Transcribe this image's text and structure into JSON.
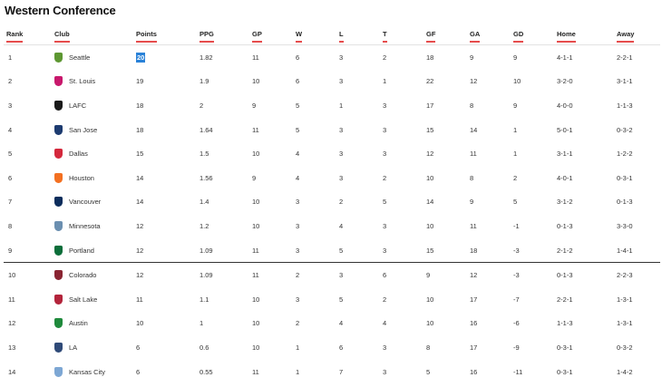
{
  "title": "Western Conference",
  "columns": [
    "Rank",
    "Club",
    "Points",
    "PPG",
    "GP",
    "W",
    "L",
    "T",
    "GF",
    "GA",
    "GD",
    "Home",
    "Away"
  ],
  "rows": [
    {
      "rank": "1",
      "club": "Seattle",
      "color": "#5d9732",
      "points": "20",
      "ppg": "1.82",
      "gp": "11",
      "w": "6",
      "l": "3",
      "t": "2",
      "gf": "18",
      "ga": "9",
      "gd": "9",
      "home": "4-1-1",
      "away": "2-2-1"
    },
    {
      "rank": "2",
      "club": "St. Louis",
      "color": "#c8186c",
      "points": "19",
      "ppg": "1.9",
      "gp": "10",
      "w": "6",
      "l": "3",
      "t": "1",
      "gf": "22",
      "ga": "12",
      "gd": "10",
      "home": "3-2-0",
      "away": "3-1-1"
    },
    {
      "rank": "3",
      "club": "LAFC",
      "color": "#1a1a1a",
      "points": "18",
      "ppg": "2",
      "gp": "9",
      "w": "5",
      "l": "1",
      "t": "3",
      "gf": "17",
      "ga": "8",
      "gd": "9",
      "home": "4-0-0",
      "away": "1-1-3"
    },
    {
      "rank": "4",
      "club": "San Jose",
      "color": "#1d3b70",
      "points": "18",
      "ppg": "1.64",
      "gp": "11",
      "w": "5",
      "l": "3",
      "t": "3",
      "gf": "15",
      "ga": "14",
      "gd": "1",
      "home": "5-0-1",
      "away": "0-3-2"
    },
    {
      "rank": "5",
      "club": "Dallas",
      "color": "#d4283c",
      "points": "15",
      "ppg": "1.5",
      "gp": "10",
      "w": "4",
      "l": "3",
      "t": "3",
      "gf": "12",
      "ga": "11",
      "gd": "1",
      "home": "3-1-1",
      "away": "1-2-2"
    },
    {
      "rank": "6",
      "club": "Houston",
      "color": "#f37021",
      "points": "14",
      "ppg": "1.56",
      "gp": "9",
      "w": "4",
      "l": "3",
      "t": "2",
      "gf": "10",
      "ga": "8",
      "gd": "2",
      "home": "4-0-1",
      "away": "0-3-1"
    },
    {
      "rank": "7",
      "club": "Vancouver",
      "color": "#0b2d5c",
      "points": "14",
      "ppg": "1.4",
      "gp": "10",
      "w": "3",
      "l": "2",
      "t": "5",
      "gf": "14",
      "ga": "9",
      "gd": "5",
      "home": "3-1-2",
      "away": "0-1-3"
    },
    {
      "rank": "8",
      "club": "Minnesota",
      "color": "#6b8fb0",
      "points": "12",
      "ppg": "1.2",
      "gp": "10",
      "w": "3",
      "l": "4",
      "t": "3",
      "gf": "10",
      "ga": "11",
      "gd": "-1",
      "home": "0-1-3",
      "away": "3-3-0"
    },
    {
      "rank": "9",
      "club": "Portland",
      "color": "#0b6e3a",
      "points": "12",
      "ppg": "1.09",
      "gp": "11",
      "w": "3",
      "l": "5",
      "t": "3",
      "gf": "15",
      "ga": "18",
      "gd": "-3",
      "home": "2-1-2",
      "away": "1-4-1"
    },
    {
      "rank": "10",
      "club": "Colorado",
      "color": "#8a2432",
      "points": "12",
      "ppg": "1.09",
      "gp": "11",
      "w": "2",
      "l": "3",
      "t": "6",
      "gf": "9",
      "ga": "12",
      "gd": "-3",
      "home": "0-1-3",
      "away": "2-2-3"
    },
    {
      "rank": "11",
      "club": "Salt Lake",
      "color": "#b3243b",
      "points": "11",
      "ppg": "1.1",
      "gp": "10",
      "w": "3",
      "l": "5",
      "t": "2",
      "gf": "10",
      "ga": "17",
      "gd": "-7",
      "home": "2-2-1",
      "away": "1-3-1"
    },
    {
      "rank": "12",
      "club": "Austin",
      "color": "#1f8a3c",
      "points": "10",
      "ppg": "1",
      "gp": "10",
      "w": "2",
      "l": "4",
      "t": "4",
      "gf": "10",
      "ga": "16",
      "gd": "-6",
      "home": "1-1-3",
      "away": "1-3-1"
    },
    {
      "rank": "13",
      "club": "LA",
      "color": "#2f4a78",
      "points": "6",
      "ppg": "0.6",
      "gp": "10",
      "w": "1",
      "l": "6",
      "t": "3",
      "gf": "8",
      "ga": "17",
      "gd": "-9",
      "home": "0-3-1",
      "away": "0-3-2"
    },
    {
      "rank": "14",
      "club": "Kansas City",
      "color": "#7da7d4",
      "points": "6",
      "ppg": "0.55",
      "gp": "11",
      "w": "1",
      "l": "7",
      "t": "3",
      "gf": "5",
      "ga": "16",
      "gd": "-11",
      "home": "0-3-1",
      "away": "1-4-2"
    }
  ],
  "colors": {
    "accent": "#e64d4d",
    "highlight": "#2a82d8"
  }
}
